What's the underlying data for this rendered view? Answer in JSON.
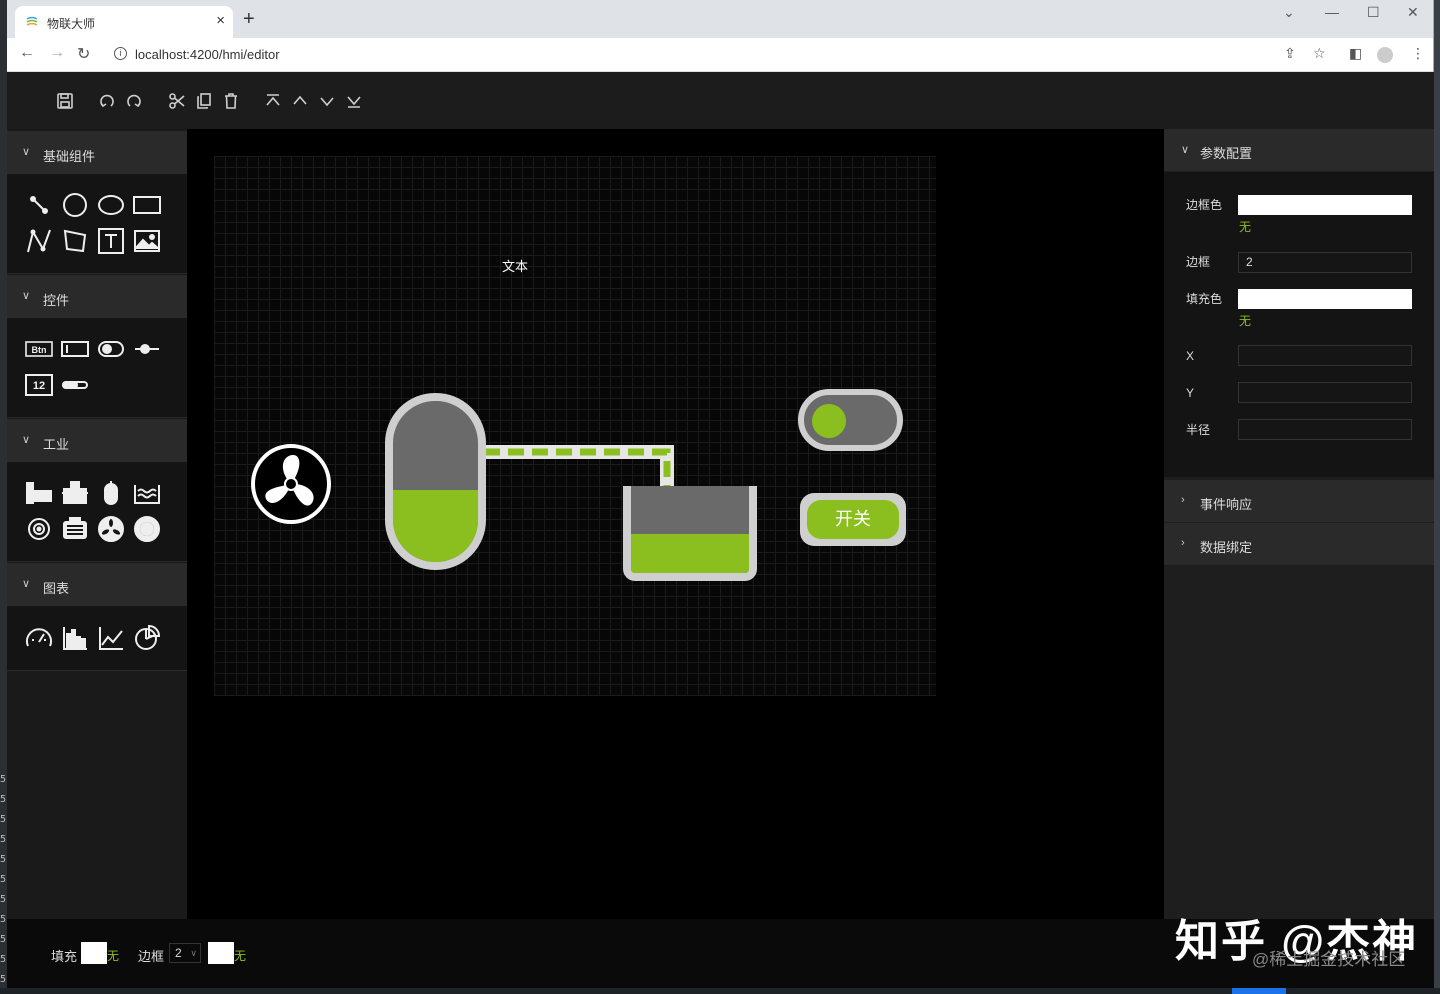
{
  "browser": {
    "tab_title": "物联大师",
    "tab_close": "×",
    "new_tab": "+",
    "url": "localhost:4200/hmi/editor"
  },
  "left_panel": {
    "sections": [
      {
        "label": "基础组件"
      },
      {
        "label": "控件"
      },
      {
        "label": "工业"
      },
      {
        "label": "图表"
      }
    ],
    "controls_btn_text": "Btn",
    "controls_num_text": "12"
  },
  "canvas": {
    "text_label": "文本",
    "switch_label": "开关",
    "toggle_on": true,
    "tank_fill_level": 0.45,
    "vessel_fill_level": 0.45
  },
  "right_panel": {
    "param_header": "参数配置",
    "props": {
      "border_color_label": "边框色",
      "border_color_value": "无",
      "border_label": "边框",
      "border_value": "2",
      "fill_color_label": "填充色",
      "fill_color_value": "无",
      "x_label": "X",
      "y_label": "Y",
      "radius_label": "半径"
    },
    "event_header": "事件响应",
    "binding_header": "数据绑定"
  },
  "bottom_bar": {
    "fill_label": "填充",
    "fill_value": "无",
    "border_label": "边框",
    "border_width": "2",
    "border_color_value": "无"
  },
  "watermark": {
    "main": "知乎 @杰神",
    "sub": "@稀土掘金技术社区"
  },
  "colors": {
    "accent_green": "#8bbf1f",
    "tank_gray": "#6a6a6a",
    "tank_frame": "#cfcfcf",
    "background": "#000000"
  },
  "backdrop_line_numbers": [
    "5",
    "5",
    "5",
    "5",
    "5",
    "5",
    "5",
    "5",
    "5",
    "5",
    "5"
  ]
}
